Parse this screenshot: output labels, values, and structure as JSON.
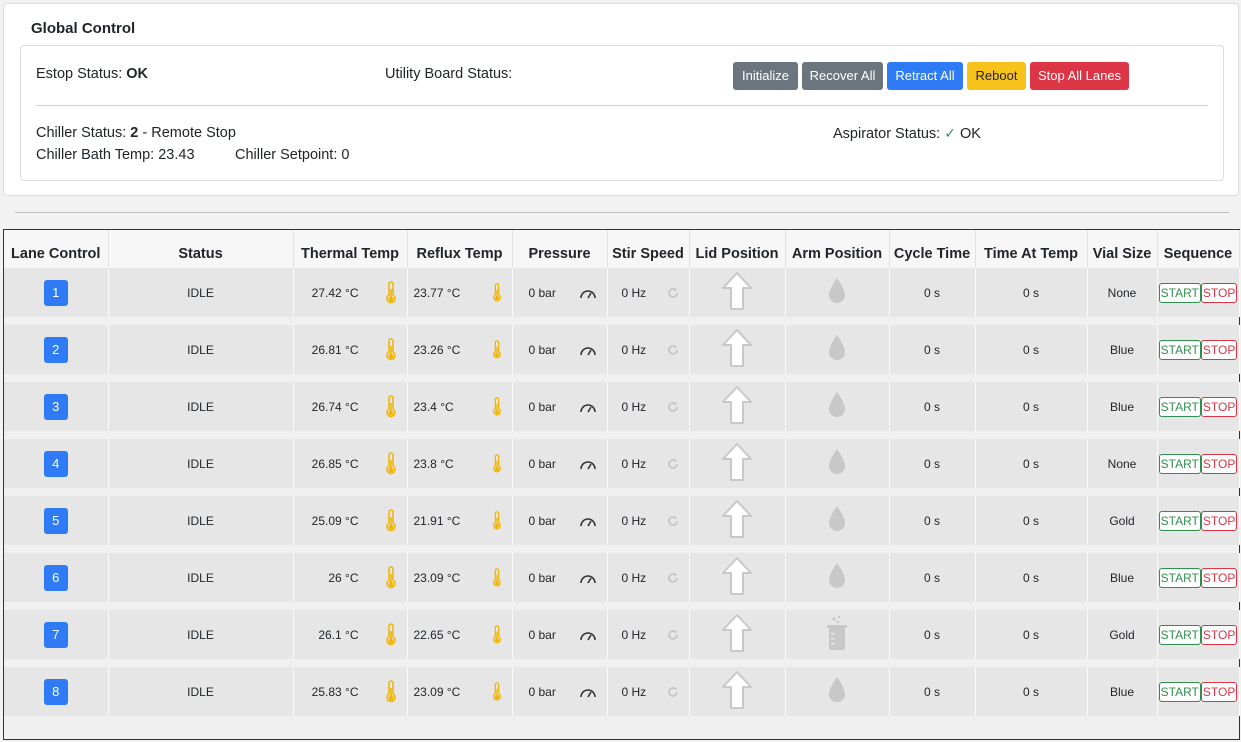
{
  "global": {
    "title": "Global Control",
    "estop_label": "Estop Status:",
    "estop_value": "OK",
    "utility_label": "Utility Board Status:",
    "buttons": {
      "initialize": "Initialize",
      "recover_all": "Recover All",
      "retract_all": "Retract All",
      "reboot": "Reboot",
      "stop_all_lanes": "Stop All Lanes"
    },
    "chiller_status_label": "Chiller Status:",
    "chiller_status_code": "2",
    "chiller_status_text": "- Remote Stop",
    "chiller_bath_label": "Chiller Bath Temp:",
    "chiller_bath_value": "23.43",
    "chiller_setpoint_label": "Chiller Setpoint:",
    "chiller_setpoint_value": "0",
    "aspirator_label": "Aspirator Status:",
    "aspirator_value": "OK",
    "colors": {
      "primary": "#2f7bf6",
      "secondary": "#6c757d",
      "warning": "#f7c31b",
      "danger": "#dc3545",
      "success": "#2f8f4f"
    }
  },
  "table": {
    "headers": [
      "Lane Control",
      "Status",
      "Thermal Temp",
      "Reflux Temp",
      "Pressure",
      "Stir Speed",
      "Lid Position",
      "Arm Position",
      "Cycle Time",
      "Time At Temp",
      "Vial Size",
      "Sequence"
    ],
    "start_label": "START",
    "stop_label": "STOP",
    "icons": {
      "thermal": "thermometer-icon",
      "reflux": "thermometer-icon",
      "pressure": "gauge-icon",
      "stir": "spinner-icon",
      "lid": "arrow-up-icon",
      "arm_drop": "droplet-icon",
      "arm_beaker": "beaker-icon"
    },
    "rows": [
      {
        "lane": "1",
        "status": "IDLE",
        "thermal": "27.42 °C",
        "reflux": "23.77 °C",
        "pressure": "0 bar",
        "stir": "0 Hz",
        "arm": "droplet",
        "cycle": "0 s",
        "at_temp": "0 s",
        "vial": "None"
      },
      {
        "lane": "2",
        "status": "IDLE",
        "thermal": "26.81 °C",
        "reflux": "23.26 °C",
        "pressure": "0 bar",
        "stir": "0 Hz",
        "arm": "droplet",
        "cycle": "0 s",
        "at_temp": "0 s",
        "vial": "Blue"
      },
      {
        "lane": "3",
        "status": "IDLE",
        "thermal": "26.74 °C",
        "reflux": "23.4 °C",
        "pressure": "0 bar",
        "stir": "0 Hz",
        "arm": "droplet",
        "cycle": "0 s",
        "at_temp": "0 s",
        "vial": "Blue"
      },
      {
        "lane": "4",
        "status": "IDLE",
        "thermal": "26.85 °C",
        "reflux": "23.8 °C",
        "pressure": "0 bar",
        "stir": "0 Hz",
        "arm": "droplet",
        "cycle": "0 s",
        "at_temp": "0 s",
        "vial": "None"
      },
      {
        "lane": "5",
        "status": "IDLE",
        "thermal": "25.09 °C",
        "reflux": "21.91 °C",
        "pressure": "0 bar",
        "stir": "0 Hz",
        "arm": "droplet",
        "cycle": "0 s",
        "at_temp": "0 s",
        "vial": "Gold"
      },
      {
        "lane": "6",
        "status": "IDLE",
        "thermal": "26 °C",
        "reflux": "23.09 °C",
        "pressure": "0 bar",
        "stir": "0 Hz",
        "arm": "droplet",
        "cycle": "0 s",
        "at_temp": "0 s",
        "vial": "Blue"
      },
      {
        "lane": "7",
        "status": "IDLE",
        "thermal": "26.1 °C",
        "reflux": "22.65 °C",
        "pressure": "0 bar",
        "stir": "0 Hz",
        "arm": "beaker",
        "cycle": "0 s",
        "at_temp": "0 s",
        "vial": "Gold"
      },
      {
        "lane": "8",
        "status": "IDLE",
        "thermal": "25.83 °C",
        "reflux": "23.09 °C",
        "pressure": "0 bar",
        "stir": "0 Hz",
        "arm": "droplet",
        "cycle": "0 s",
        "at_temp": "0 s",
        "vial": "Blue"
      }
    ]
  }
}
